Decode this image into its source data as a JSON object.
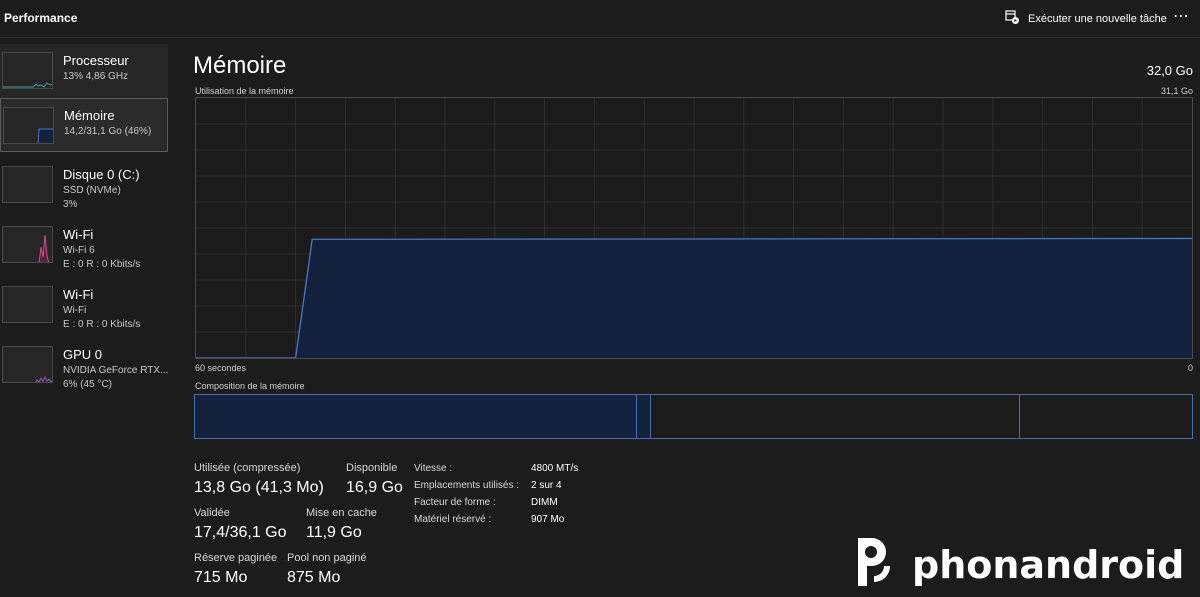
{
  "header": {
    "title": "Performance",
    "run_task_label": "Exécuter une nouvelle tâche",
    "more_label": "⋯"
  },
  "sidebar": {
    "items": [
      {
        "label": "Processeur",
        "sub1": "13%  4,86 GHz",
        "sub2": ""
      },
      {
        "label": "Mémoire",
        "sub1": "14,2/31,1 Go (46%)",
        "sub2": ""
      },
      {
        "label": "Disque 0 (C:)",
        "sub1": "SSD (NVMe)",
        "sub2": "3%"
      },
      {
        "label": "Wi-Fi",
        "sub1": "Wi-Fi 6",
        "sub2": "E : 0  R : 0 Kbits/s"
      },
      {
        "label": "Wi-Fi",
        "sub1": "Wi-Fi",
        "sub2": "E : 0  R : 0 Kbits/s"
      },
      {
        "label": "GPU 0",
        "sub1": "NVIDIA GeForce RTX...",
        "sub2": "6% (45 °C)"
      }
    ]
  },
  "main": {
    "title": "Mémoire",
    "total": "32,0 Go",
    "graph_label": "Utilisation de la mémoire",
    "graph_max": "31,1 Go",
    "graph_left_axis": "60 secondes",
    "graph_right_axis": "0",
    "composition_label": "Composition de la mémoire"
  },
  "chart_data": {
    "type": "area",
    "x_label": "60 secondes",
    "ylim": [
      0,
      31.1
    ],
    "x": [
      60,
      54,
      53,
      0
    ],
    "values": [
      0,
      0,
      14.2,
      14.3
    ],
    "fill_color": "#14213d",
    "line_color": "#4a78c2"
  },
  "composition": {
    "segments_fraction": [
      0.443,
      0.014,
      0.37,
      0.173
    ]
  },
  "stats": {
    "used_label": "Utilisée (compressée)",
    "used_value": "13,8 Go (41,3 Mo)",
    "available_label": "Disponible",
    "available_value": "16,9 Go",
    "committed_label": "Validée",
    "committed_value": "17,4/36,1 Go",
    "cached_label": "Mise en cache",
    "cached_value": "11,9 Go",
    "paged_label": "Réserve paginée",
    "paged_value": "715 Mo",
    "nonpaged_label": "Pool non paginé",
    "nonpaged_value": "875 Mo"
  },
  "specs": {
    "speed_label": "Vitesse :",
    "speed_value": "4800 MT/s",
    "slots_label": "Emplacements utilisés :",
    "slots_value": "2 sur 4",
    "form_label": "Facteur de forme :",
    "form_value": "DIMM",
    "reserved_label": "Matériel réservé :",
    "reserved_value": "907 Mo"
  },
  "watermark": {
    "text": "phonandroid"
  },
  "colors": {
    "background": "#1c1c1c",
    "accent_blue": "#4a78c2",
    "cpu_line": "#3aa3a3",
    "wifi_line": "#d0508a",
    "gpu_line": "#a050c0"
  }
}
